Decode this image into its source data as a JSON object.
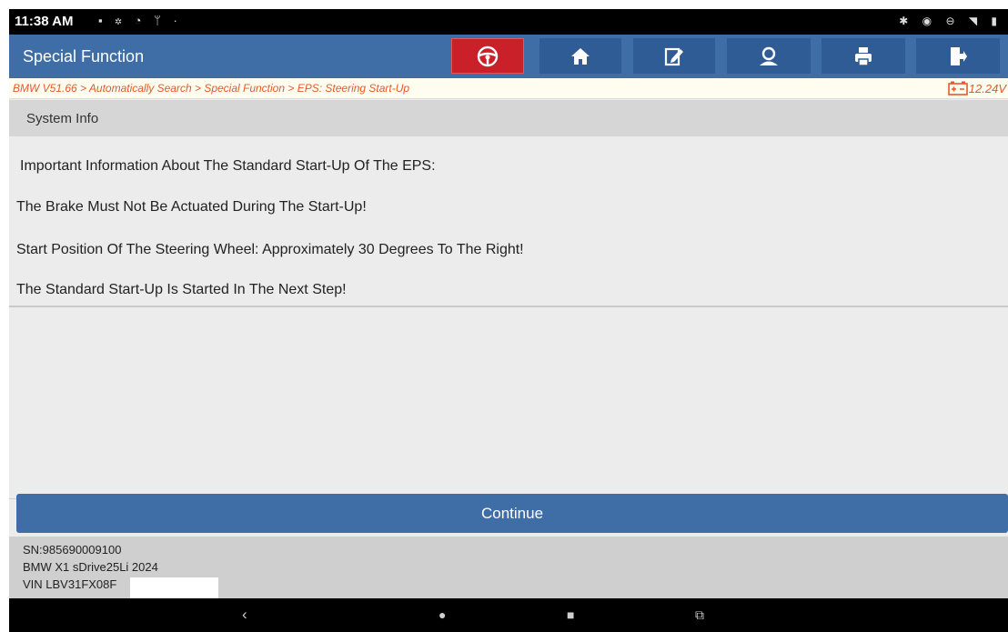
{
  "status_bar": {
    "time": "11:38 AM",
    "icons": [
      "photo-icon",
      "settings-icon",
      "wifi-icon",
      "usb-icon",
      "dot"
    ],
    "right_icons": [
      "bluetooth-icon",
      "record-icon",
      "dnd-icon",
      "wifi-icon",
      "battery-icon"
    ]
  },
  "header": {
    "title": "Special Function",
    "toolbar": [
      "steering-wheel",
      "home",
      "edit",
      "account",
      "print",
      "exit"
    ]
  },
  "breadcrumb": {
    "path": "BMW V51.66 > Automatically Search > Special Function > EPS: Steering Start-Up",
    "voltage": "12.24V"
  },
  "section": {
    "title": "System Info"
  },
  "messages": [
    "Important Information About The Standard Start-Up Of The EPS:",
    "The Brake Must Not Be Actuated During The Start-Up!",
    "Start Position Of The Steering Wheel: Approximately 30 Degrees To The Right!",
    "The Standard Start-Up Is Started In The Next Step!"
  ],
  "actions": {
    "continue_label": "Continue"
  },
  "footer": {
    "sn": "SN:985690009100",
    "vehicle": "BMW X1 sDrive25Li 2024",
    "vin": "VIN LBV31FX08F"
  },
  "colors": {
    "toolbar": "#3f6ea7",
    "button": "#3f6ea7",
    "accent_red": "#c9202a",
    "breadcrumb": "#e4592a"
  }
}
